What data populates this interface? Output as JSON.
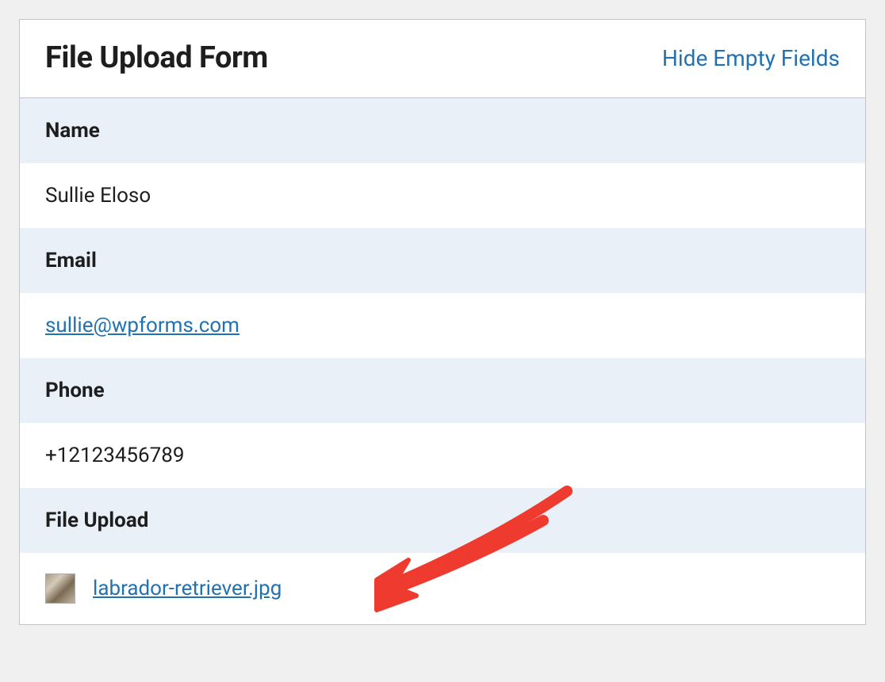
{
  "header": {
    "title": "File Upload Form",
    "hide_link": "Hide Empty Fields"
  },
  "fields": {
    "name": {
      "label": "Name",
      "value": "Sullie Eloso"
    },
    "email": {
      "label": "Email",
      "value": "sullie@wpforms.com"
    },
    "phone": {
      "label": "Phone",
      "value": "+12123456789"
    },
    "file_upload": {
      "label": "File Upload",
      "filename": "labrador-retriever.jpg"
    }
  }
}
